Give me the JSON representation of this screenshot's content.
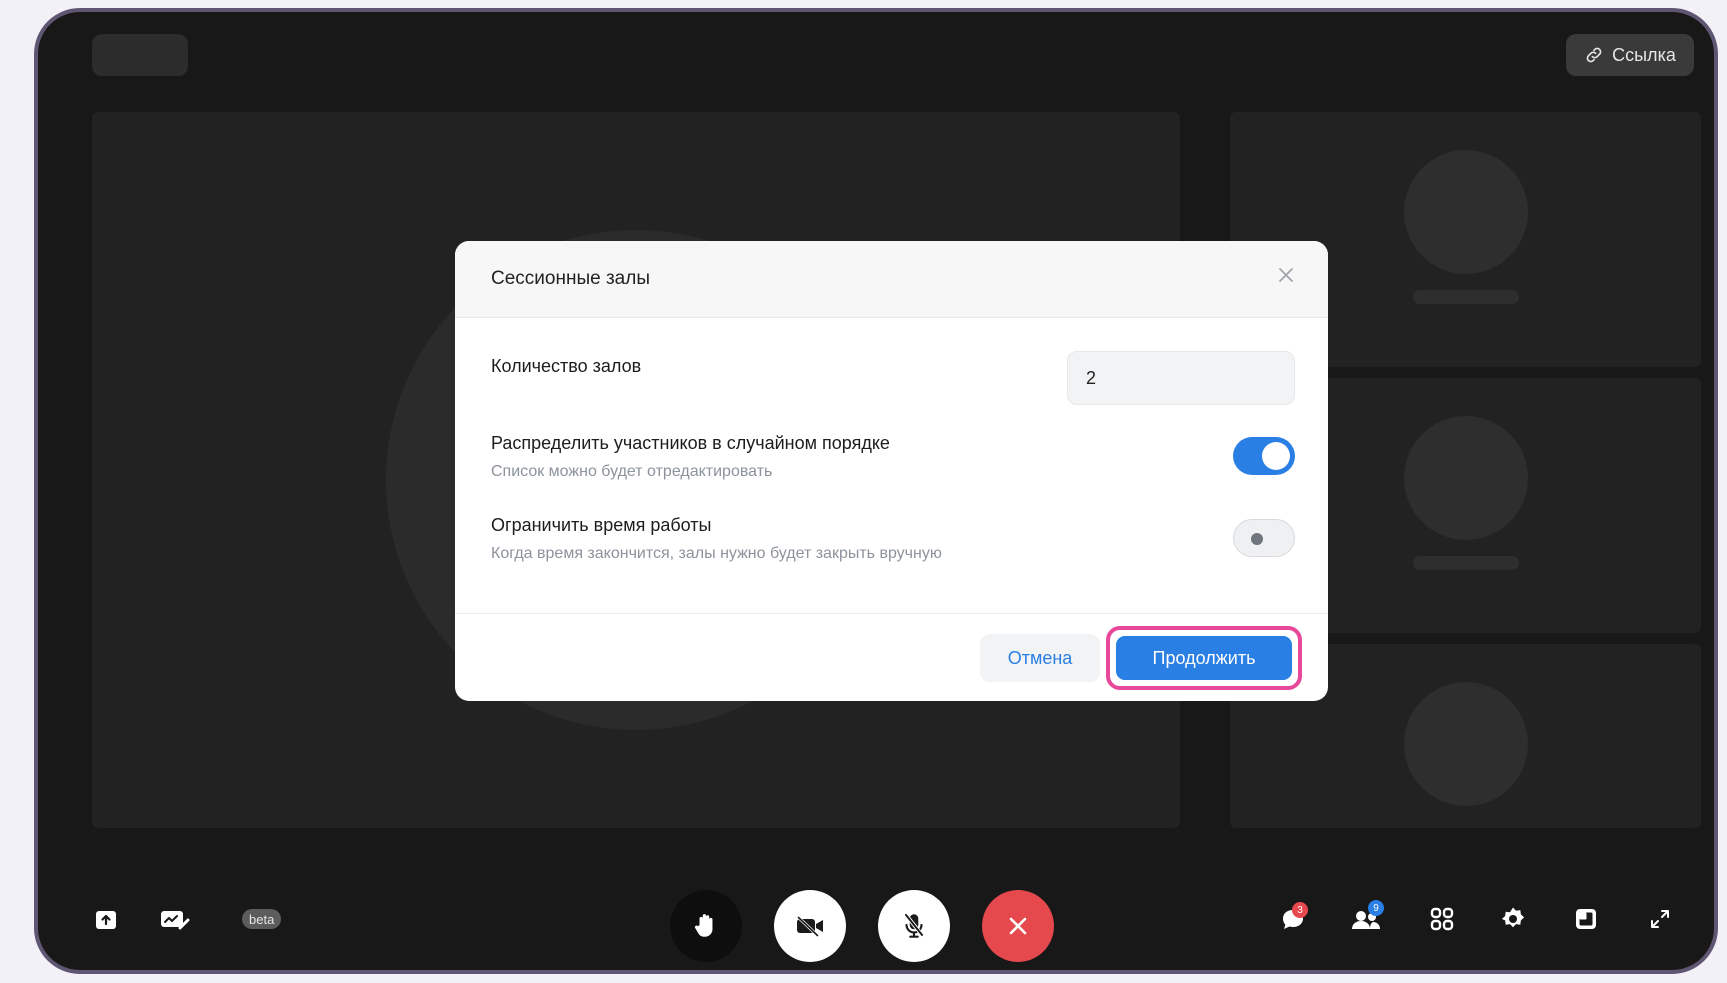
{
  "header": {
    "link_label": "Ссылка"
  },
  "toolbar_left": {
    "beta_label": "beta"
  },
  "badges": {
    "chat_count": "3",
    "participants_count": "9"
  },
  "modal": {
    "title": "Сессионные залы",
    "rooms_label": "Количество залов",
    "rooms_value": "2",
    "random_label": "Распределить участников в случайном порядке",
    "random_sub": "Список можно будет отредактировать",
    "random_enabled": true,
    "limit_label": "Ограничить время работы",
    "limit_sub": "Когда время закончится, залы нужно будет закрыть вручную",
    "limit_enabled": false,
    "cancel_label": "Отмена",
    "continue_label": "Продолжить"
  },
  "colors": {
    "accent": "#2a7fe4",
    "highlight": "#e8489a",
    "end_call": "#e5484d",
    "frame": "#5e5672",
    "background": "#181818"
  },
  "icons": {
    "header": [
      "link-icon"
    ],
    "left": [
      "share-screen-icon",
      "whiteboard-icon"
    ],
    "center": [
      "raise-hand-icon",
      "camera-off-icon",
      "mic-off-icon",
      "end-call-icon"
    ],
    "right": [
      "chat-icon",
      "participants-icon",
      "grid-icon",
      "settings-icon",
      "layout-icon",
      "fullscreen-icon"
    ],
    "modal": [
      "close-icon"
    ]
  }
}
